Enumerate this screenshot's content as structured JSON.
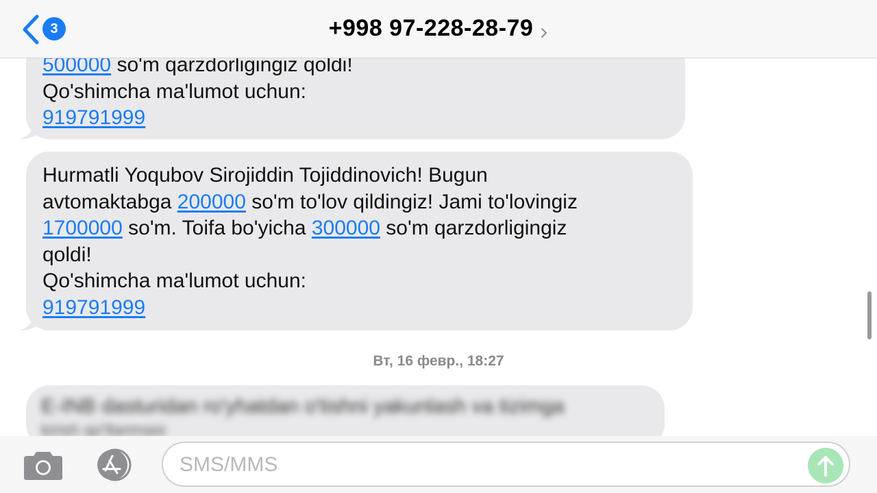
{
  "header": {
    "back_badge": "3",
    "contact": "+998 97-228-28-79"
  },
  "message1": {
    "line1_link": "500000",
    "line1_rest": " so'm qarzdorligingiz qoldi!",
    "line2": "Qo'shimcha ma'lumot uchun:",
    "phone_link": "919791999"
  },
  "message2": {
    "line1": "Hurmatli Yoqubov Sirojiddin Tojiddinovich! Bugun",
    "line2_a": "avtomaktabga ",
    "line2_link": "200000",
    "line2_b": " so'm to'lov qildingiz! Jami to'lovingiz",
    "line3_link1": "1700000",
    "line3_mid": " so'm. Toifa bo'yicha ",
    "line3_link2": "300000",
    "line3_b": " so'm qarzdorligingiz",
    "line4": "qoldi!",
    "line5": "Qo'shimcha ma'lumot uchun:",
    "phone_link": "919791999"
  },
  "timestamp": "Вт, 16 февр., 18:27",
  "message3_blurred": {
    "line1": "E-INB dasturidan ro'yhatdan o'tishni yakunlash va tizimga",
    "line2": "kirish qo'llanmasi"
  },
  "input": {
    "placeholder": "SMS/MMS"
  },
  "colors": {
    "accent": "#1a7cf5",
    "bubble": "#e9e9eb",
    "send": "#a8e6b8"
  },
  "icons": [
    "back-chevron-icon",
    "camera-icon",
    "app-store-icon",
    "send-arrow-icon",
    "chevron-right-icon"
  ]
}
